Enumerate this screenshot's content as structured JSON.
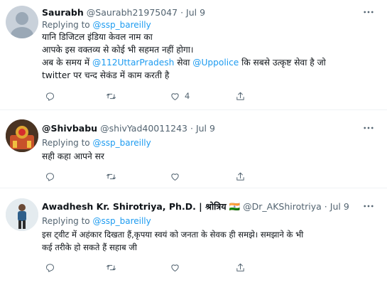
{
  "tweets": [
    {
      "name": "Saurabh",
      "handle": "@Saurabh21975047",
      "date": "Jul 9",
      "replying_prefix": "Replying to",
      "replying_to": "@ssp_bareilly",
      "line1": "यानि डिजिटल इंडिया केवल  नाम का",
      "line2": "आपके इस वक्तव्य से कोई भी सहमत नहीं होगा।",
      "line3_a": "अब के समय में ",
      "line3_mention1": "@112UttarPradesh",
      "line3_b": " सेवा ",
      "line3_mention2": "@Uppolice",
      "line3_c": " कि सबसे उत्कृष्ट सेवा है जो",
      "line4": "twitter पर चन्द सेकंड में काम करती है",
      "likes": "4"
    },
    {
      "name": "@Shivbabu",
      "handle": "@shivYad40011243",
      "date": "Jul 9",
      "replying_prefix": "Replying to",
      "replying_to": "@ssp_bareilly",
      "line1": "सही कहा आपने सर"
    },
    {
      "name": "Awadhesh Kr. Shirotriya, Ph.D. | श्रोत्रिय",
      "flag": "🇮🇳",
      "handle": "@Dr_AKShirotriya",
      "date": "Jul 9",
      "replying_prefix": "Replying to",
      "replying_to": "@ssp_bareilly",
      "line1": "इस ट्वीट में अहंकार दिखता हैं,कृपया स्वयं को जनता के सेवक ही समझे। समझाने के भी",
      "line2": "कई तरीके हो सकते हैं सहाब जी"
    }
  ],
  "separator": "·",
  "colors": {
    "link": "#1d9bf0",
    "secondary": "#536471",
    "divider": "#eff3f4"
  }
}
